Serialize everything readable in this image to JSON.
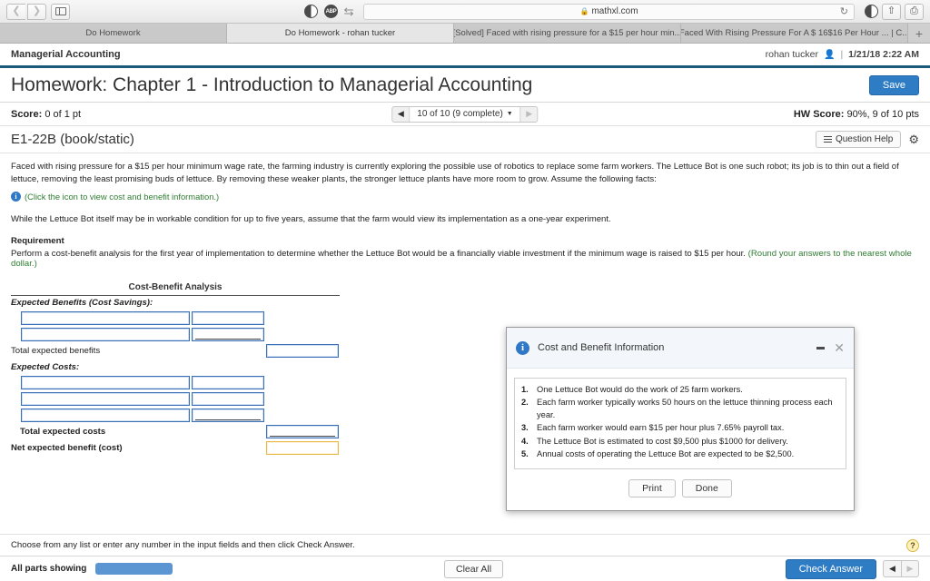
{
  "browser": {
    "url": "mathxl.com",
    "lock_icon": "lock-icon",
    "back_icon": "back-arrow-icon",
    "forward_icon": "forward-arrow-icon",
    "sidebar_icon": "sidebar-toggle-icon",
    "reload_icon": "reload-icon",
    "share_icon": "share-icon",
    "tabs_overview_icon": "tabs-overview-icon",
    "new_tab_label": "+",
    "tabs": [
      {
        "title": "Do Homework",
        "active": false
      },
      {
        "title": "Do Homework - rohan tucker",
        "active": true
      },
      {
        "title": "[Solved] Faced with rising pressure for a $15 per hour min...",
        "active": false
      },
      {
        "title": "Faced With Rising Pressure For A $ 16$16 Per Hour ... | C...",
        "active": false
      }
    ]
  },
  "app_header": {
    "course": "Managerial Accounting",
    "user": "rohan tucker",
    "user_icon": "user-icon",
    "separator": "|",
    "datetime": "1/21/18 2:22 AM"
  },
  "title_row": {
    "title": "Homework: Chapter 1 - Introduction to Managerial Accounting",
    "save_label": "Save"
  },
  "score_row": {
    "score_label": "Score:",
    "score_value": "0 of 1 pt",
    "nav_prev_icon": "prev-question-icon",
    "nav_next_icon": "next-question-icon",
    "nav_label": "10 of 10 (9 complete)",
    "nav_caret_icon": "chevron-down-icon",
    "hw_score_label": "HW Score:",
    "hw_score_value": "90%, 9 of 10 pts"
  },
  "exercise_row": {
    "exercise_id": "E1-22B (book/static)",
    "question_help_label": "Question Help",
    "list_icon": "list-icon",
    "gear_icon": "gear-icon"
  },
  "problem": {
    "paragraph1": "Faced with rising pressure for a $15 per hour minimum wage rate, the farming industry is currently exploring the possible use of robotics to replace some farm workers. The Lettuce Bot is one such robot; its job is to thin out a field of lettuce, removing the least promising buds of lettuce. By removing these weaker plants, the stronger lettuce plants have more room to grow. Assume the following facts:",
    "info_icon": "info-icon",
    "hint": "(Click the icon to view cost and benefit information.)",
    "paragraph2": "While the Lettuce Bot itself may be in workable condition for up to five years, assume that the farm would view its implementation as a one-year experiment.",
    "requirement_heading": "Requirement",
    "requirement_text": "Perform a cost-benefit analysis for the first year of implementation to determine whether the Lettuce Bot would be a financially viable investment if the minimum wage is raised to $15 per hour.",
    "round_note": "(Round your answers to the nearest whole dollar.)"
  },
  "cba": {
    "title": "Cost-Benefit Analysis",
    "benefits_heading": "Expected Benefits (Cost Savings):",
    "total_benefits_label": "Total expected benefits",
    "costs_heading": "Expected Costs:",
    "total_costs_label": "Total expected costs",
    "net_label": "Net expected benefit (cost)",
    "benefit_rows": [
      {
        "desc_value": "",
        "amount_value": ""
      },
      {
        "desc_value": "",
        "amount_value": ""
      }
    ],
    "cost_rows": [
      {
        "desc_value": "",
        "amount_value": ""
      },
      {
        "desc_value": "",
        "amount_value": ""
      },
      {
        "desc_value": "",
        "amount_value": ""
      }
    ],
    "total_benefits_value": "",
    "total_costs_value": "",
    "net_value": ""
  },
  "dialog": {
    "info_icon": "info-icon",
    "title": "Cost and Benefit Information",
    "minimize_icon": "minimize-icon",
    "close_icon": "close-icon",
    "items": [
      "One Lettuce Bot would do the work of 25 farm workers.",
      "Each farm worker typically works 50 hours on the lettuce thinning process each year.",
      "Each farm worker would earn $15 per hour plus 7.65% payroll tax.",
      "The Lettuce Bot is estimated to cost $9,500 plus $1000 for delivery.",
      "Annual costs of operating the Lettuce Bot are expected to be $2,500."
    ],
    "print_label": "Print",
    "done_label": "Done"
  },
  "footer": {
    "hint": "Choose from any list or enter any number in the input fields and then click Check Answer.",
    "help_icon": "question-mark-icon",
    "all_parts_label": "All parts showing",
    "clear_all_label": "Clear All",
    "check_answer_label": "Check Answer",
    "pager_prev_icon": "prev-part-icon",
    "pager_next_icon": "next-part-icon"
  },
  "colors": {
    "accent_blue": "#2e7cc4",
    "header_rule": "#1a5a7a",
    "input_border": "#3b6fb5",
    "answer_yellow": "#e8b84b",
    "hint_green": "#2f7d32",
    "progress_blue": "#5b95d2"
  }
}
